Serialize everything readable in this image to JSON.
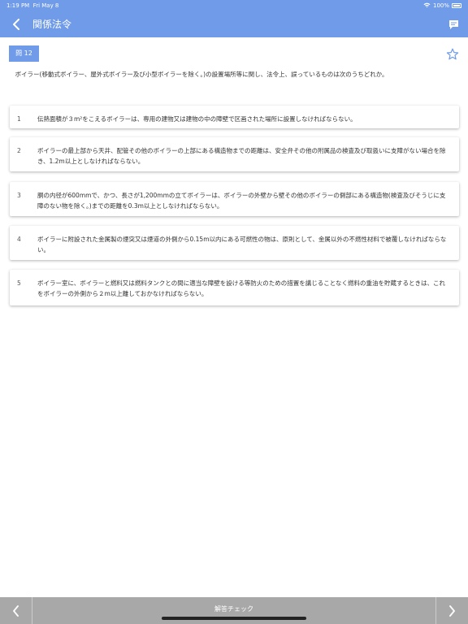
{
  "status": {
    "time": "1:19 PM",
    "date": "Fri May 8",
    "battery": "100%"
  },
  "nav": {
    "title": "関係法令",
    "back_icon": "chevron-left-icon",
    "comment_icon": "comment-icon"
  },
  "question": {
    "badge": "問 12",
    "text": "ボイラー(移動式ボイラー、屋外式ボイラー及び小型ボイラーを除く。)の設置場所等に関し、法令上、誤っているものは次のうちどれか。",
    "star_icon": "star-outline-icon"
  },
  "choices": [
    {
      "number": "1",
      "text": "伝熱面積が３m²をこえるボイラーは、専用の建物又は建物の中の障壁で区画された場所に設置しなければならない。"
    },
    {
      "number": "2",
      "text": "ボイラーの最上部から天井、配管その他のボイラーの上部にある構造物までの距離は、安全弁その他の附属品の検査及び取扱いに支障がない場合を除き、1.2m以上としなければならない。"
    },
    {
      "number": "3",
      "text": "胴の内径が600mmで、かつ、長さが1,200mmの立てボイラーは、ボイラーの外壁から壁その他のボイラーの側部にある構造物(検査及びそうじに支障のない物を除く。)までの距離を0.3m以上としなければならない。"
    },
    {
      "number": "4",
      "text": "ボイラーに附設された金属製の煙突又は煙道の外側から0.15m以内にある可燃性の物は、原則として、金属以外の不燃性材料で被覆しなければならない。"
    },
    {
      "number": "5",
      "text": "ボイラー室に、ボイラーと燃料又は燃料タンクとの間に適当な障壁を設ける等防火のための措置を講じることなく燃料の重油を貯蔵するときは、これをボイラーの外側から２m以上離しておかなければならない。"
    }
  ],
  "bottom": {
    "answer_check": "解答チェック",
    "prev_icon": "chevron-left-icon",
    "next_icon": "chevron-right-icon"
  },
  "colors": {
    "accent": "#6f9be8",
    "bottom_bar": "#a8a8a8"
  }
}
